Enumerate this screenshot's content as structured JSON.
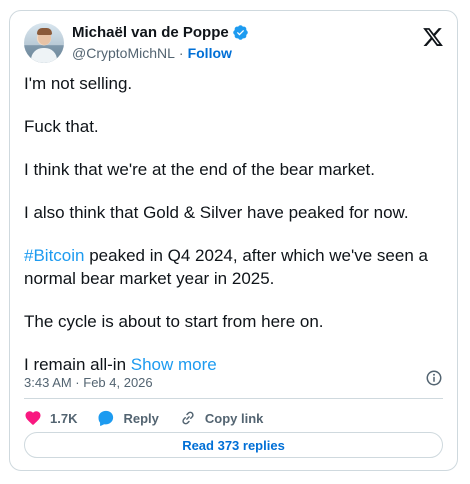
{
  "author": {
    "name": "Michaël van de Poppe",
    "handle": "@CryptoMichNL",
    "separator": "·",
    "follow_label": "Follow"
  },
  "tweet": {
    "p1": "I'm not selling.",
    "p2": "Fuck that.",
    "p3": "I think that we're at the end of the bear market.",
    "p4": "I also think that Gold & Silver have peaked for now.",
    "p5_hashtag": "#Bitcoin",
    "p5_rest": " peaked in Q4 2024, after which we've seen a normal bear market year in 2025.",
    "p6": "The cycle is about to start from here on.",
    "p7": "I remain all-in ",
    "show_more": "Show more"
  },
  "meta": {
    "timestamp": "3:43 AM · Feb 4, 2026"
  },
  "actions": {
    "like_count": "1.7K",
    "reply_label": "Reply",
    "copy_link_label": "Copy link"
  },
  "replies_button": "Read 373 replies",
  "colors": {
    "link": "#1d9bf0",
    "follow": "#006fd6",
    "like": "#f91880",
    "verified": "#1d9bf0"
  },
  "icons": [
    "x-logo-icon",
    "verified-badge-icon",
    "info-icon",
    "heart-icon",
    "reply-icon",
    "link-icon"
  ]
}
